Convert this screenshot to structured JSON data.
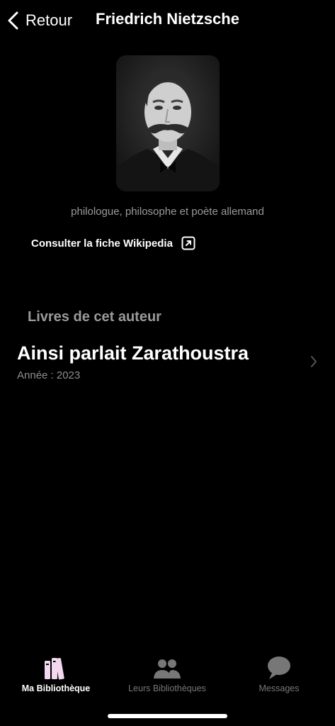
{
  "nav": {
    "back_label": "Retour",
    "title": "Friedrich Nietzsche"
  },
  "author": {
    "description": "philologue, philosophe et poète allemand",
    "wiki_label": "Consulter la fiche Wikipedia"
  },
  "books_section": {
    "title": "Livres de cet auteur",
    "items": [
      {
        "title": "Ainsi parlait Zarathoustra",
        "year": "Année : 2023"
      }
    ]
  },
  "tabbar": {
    "tabs": [
      {
        "label": "Ma Bibliothèque",
        "icon": "books-icon",
        "active": true
      },
      {
        "label": "Leurs Bibliothèques",
        "icon": "people-icon",
        "active": false
      },
      {
        "label": "Messages",
        "icon": "chat-bubble-icon",
        "active": false
      }
    ]
  },
  "colors": {
    "accent": "#ffffff",
    "secondary_text": "#9a9a9a",
    "inactive_tab": "#777777",
    "active_icon": "#f3d9ef"
  }
}
